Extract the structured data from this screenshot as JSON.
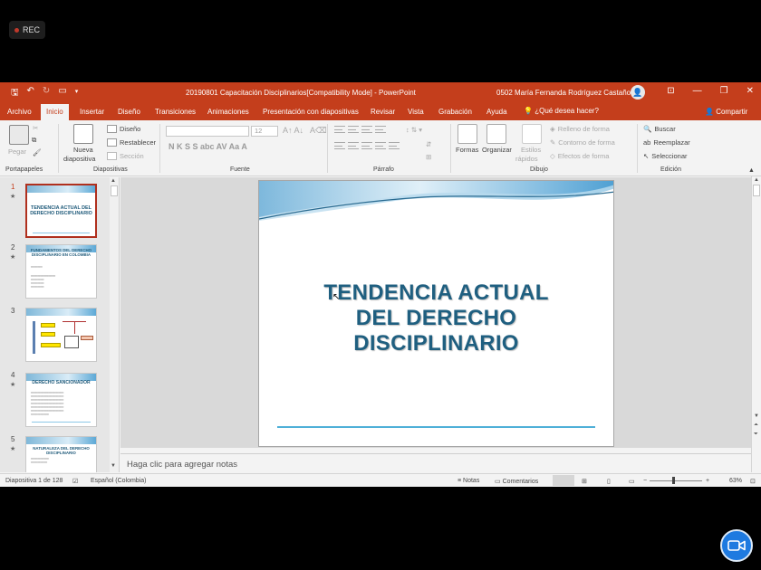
{
  "recording": {
    "label": "REC"
  },
  "titlebar": {
    "file_title": "20190801 Capacitación Disciplinarios[Compatibility Mode]  -  PowerPoint",
    "user": "0502 María Fernanda Rodríguez Castaño"
  },
  "tabs": [
    "Archivo",
    "Inicio",
    "Insertar",
    "Diseño",
    "Transiciones",
    "Animaciones",
    "Presentación con diapositivas",
    "Revisar",
    "Vista",
    "Grabación",
    "Ayuda"
  ],
  "tell_me": "¿Qué desea hacer?",
  "share": "Compartir",
  "ribbon": {
    "clipboard": {
      "paste": "Pegar",
      "label": "Portapapeles"
    },
    "slides": {
      "new_slide_1": "Nueva",
      "new_slide_2": "diapositiva",
      "layout": "Diseño",
      "reset": "Restablecer",
      "section": "Sección",
      "label": "Diapositivas"
    },
    "font": {
      "font_size": "12",
      "format_buttons": "N  K  S  S  abc  AV   Aa   A",
      "label": "Fuente"
    },
    "paragraph": {
      "label": "Párrafo"
    },
    "drawing": {
      "shapes": "Formas",
      "arrange": "Organizar",
      "styles_1": "Estilos",
      "styles_2": "rápidos",
      "fill": "Relleno de forma",
      "outline": "Contorno de forma",
      "effects": "Efectos de forma",
      "label": "Dibujo"
    },
    "editing": {
      "find": "Buscar",
      "replace": "Reemplazar",
      "select": "Seleccionar",
      "label": "Edición"
    }
  },
  "thumbnails": [
    {
      "num": "1",
      "title": "TENDENCIA ACTUAL DEL DERECHO DISCIPLINARIO"
    },
    {
      "num": "2",
      "title": "FUNDAMENTOS DEL DERECHO DISCIPLINARIO EN COLOMBIA"
    },
    {
      "num": "3",
      "title": ""
    },
    {
      "num": "4",
      "title": "DERECHO SANCIONADOR"
    },
    {
      "num": "5",
      "title": "NATURALEZA DEL DERECHO DISCIPLINARIO"
    }
  ],
  "slide": {
    "title_line1": "TENDENCIA ACTUAL",
    "title_line2": "DEL  DERECHO",
    "title_line3": "DISCIPLINARIO"
  },
  "notes_placeholder": "Haga clic para agregar notas",
  "status": {
    "slide_count": "Diapositiva 1 de 128",
    "language": "Español (Colombia)",
    "notes": "Notas",
    "comments": "Comentarios",
    "zoom": "63%"
  },
  "colors": {
    "accent": "#c43e1c",
    "slide_title": "#1f5f80",
    "camera": "#1e7ae0"
  }
}
